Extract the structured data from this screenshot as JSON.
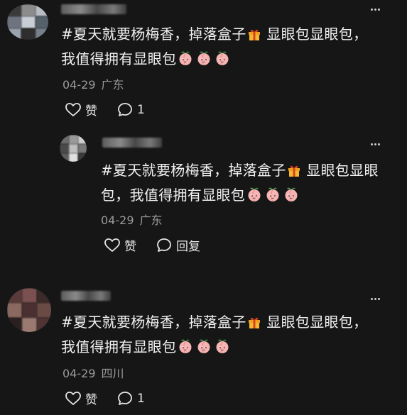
{
  "comments": [
    {
      "text_a": "#夏天就要杨梅香，掉落盒子",
      "text_b": " 显眼包显眼包，",
      "text_c": "我值得拥有显眼包",
      "date": "04-29",
      "location": "广东",
      "like_label": "赞",
      "reply_label": "1",
      "avatar_colors": [
        "#3a3a3a",
        "#8c8c8c",
        "#b8bcc4",
        "#6d7480",
        "#c9ced6",
        "#55606b",
        "#9aa2ad",
        "#2e2e2e",
        "#77808b"
      ]
    },
    {
      "text_a": "#夏天就要杨梅香，掉落盒子",
      "text_b": " 显眼包显眼",
      "text_c": "包，我值得拥有显眼包",
      "date": "04-29",
      "location": "广东",
      "like_label": "赞",
      "reply_label": "回复",
      "avatar_colors": [
        "#6c6c6c",
        "#9a9a9a",
        "#d0d0d0",
        "#4a4a4a",
        "#bfbfbf",
        "#7a7a7a",
        "#5c5c5c",
        "#e0e0e0",
        "#3a3a3a"
      ]
    },
    {
      "text_a": "#夏天就要杨梅香，掉落盒子",
      "text_b": " 显眼包显眼包，",
      "text_c": "我值得拥有显眼包",
      "date": "04-29",
      "location": "四川",
      "like_label": "赞",
      "reply_label": "1",
      "avatar_colors": [
        "#5a3a3a",
        "#7a5050",
        "#3a2a2a",
        "#8a6a60",
        "#4a3030",
        "#6a4a44",
        "#2a2020",
        "#9a7a70",
        "#503434"
      ]
    }
  ],
  "icons": {
    "gift": "gift-icon",
    "peach": "peach-emoji-icon",
    "like": "thumbs-up-icon",
    "comment": "comment-bubble-icon",
    "more": "more-dots-icon"
  }
}
